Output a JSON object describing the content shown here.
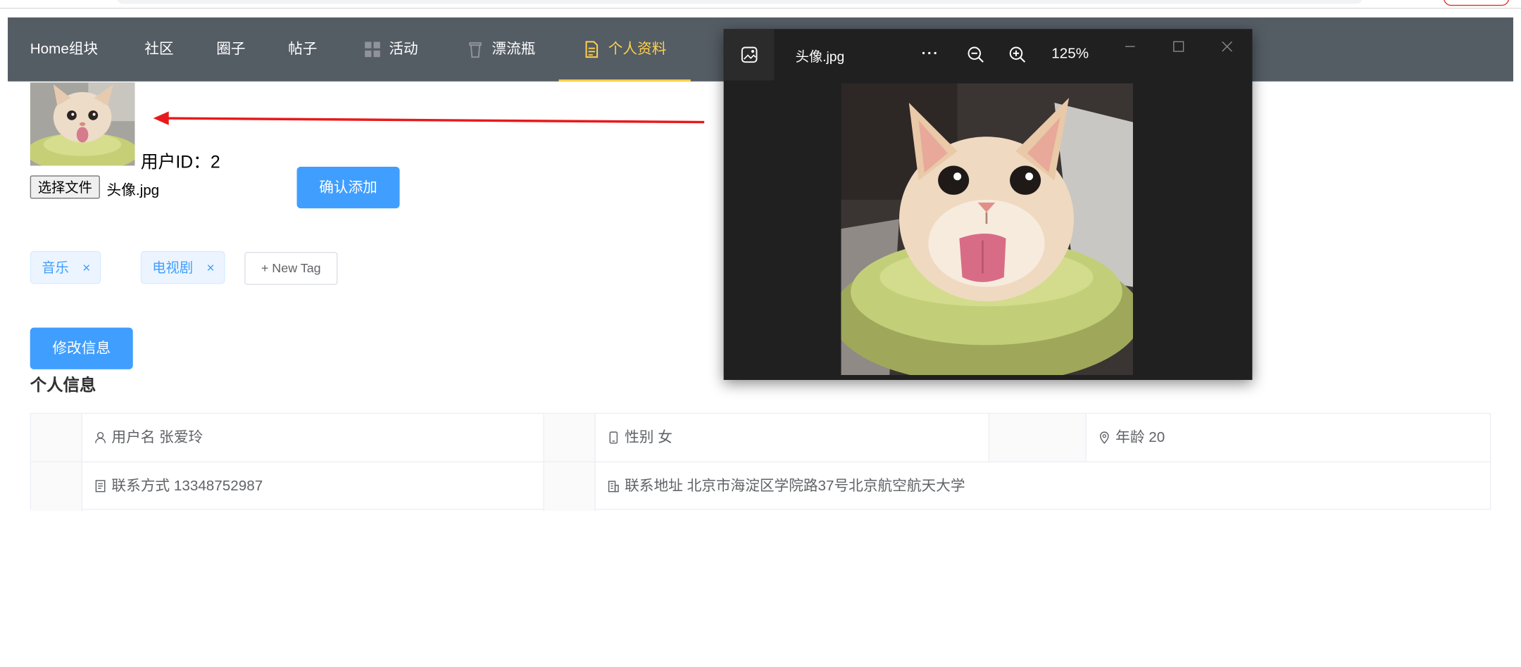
{
  "nav": {
    "items": [
      {
        "label": "Home组块"
      },
      {
        "label": "社区"
      },
      {
        "label": "圈子"
      },
      {
        "label": "帖子"
      },
      {
        "label": "活动",
        "icon": "grid-icon"
      },
      {
        "label": "漂流瓶",
        "icon": "bottle-icon"
      },
      {
        "label": "个人资料",
        "icon": "document-icon",
        "active": true
      }
    ],
    "colors": {
      "background": "#545c64",
      "text": "#ffffff",
      "active": "#ffd04b"
    }
  },
  "profile": {
    "user_id_label": "用户ID：2",
    "choose_file_label": "选择文件",
    "file_name": "头像.jpg",
    "confirm_add_label": "确认添加",
    "edit_info_label": "修改信息"
  },
  "tags": {
    "items": [
      {
        "label": "音乐"
      },
      {
        "label": "电视剧"
      }
    ],
    "close_glyph": "×",
    "new_tag_label": "+ New Tag"
  },
  "info": {
    "section_title": "个人信息",
    "username": {
      "label": "用户名",
      "value": "张爱玲",
      "icon": "user-icon"
    },
    "gender": {
      "label": "性别",
      "value": "女",
      "icon": "mobile-icon"
    },
    "age": {
      "label": "年龄",
      "value": "20",
      "icon": "location-icon"
    },
    "contact": {
      "label": "联系方式",
      "value": "13348752987",
      "icon": "tickets-icon"
    },
    "address": {
      "label": "联系地址",
      "value": "北京市海淀区学院路37号北京航空航天大学",
      "icon": "office-building-icon"
    }
  },
  "viewer": {
    "title": "头像.jpg",
    "more": "···",
    "zoom": "125%"
  },
  "colors": {
    "primary": "#409eff",
    "tag_bg": "#ecf5ff",
    "arrow": "#e8191b",
    "viewer_bg": "#202020"
  }
}
